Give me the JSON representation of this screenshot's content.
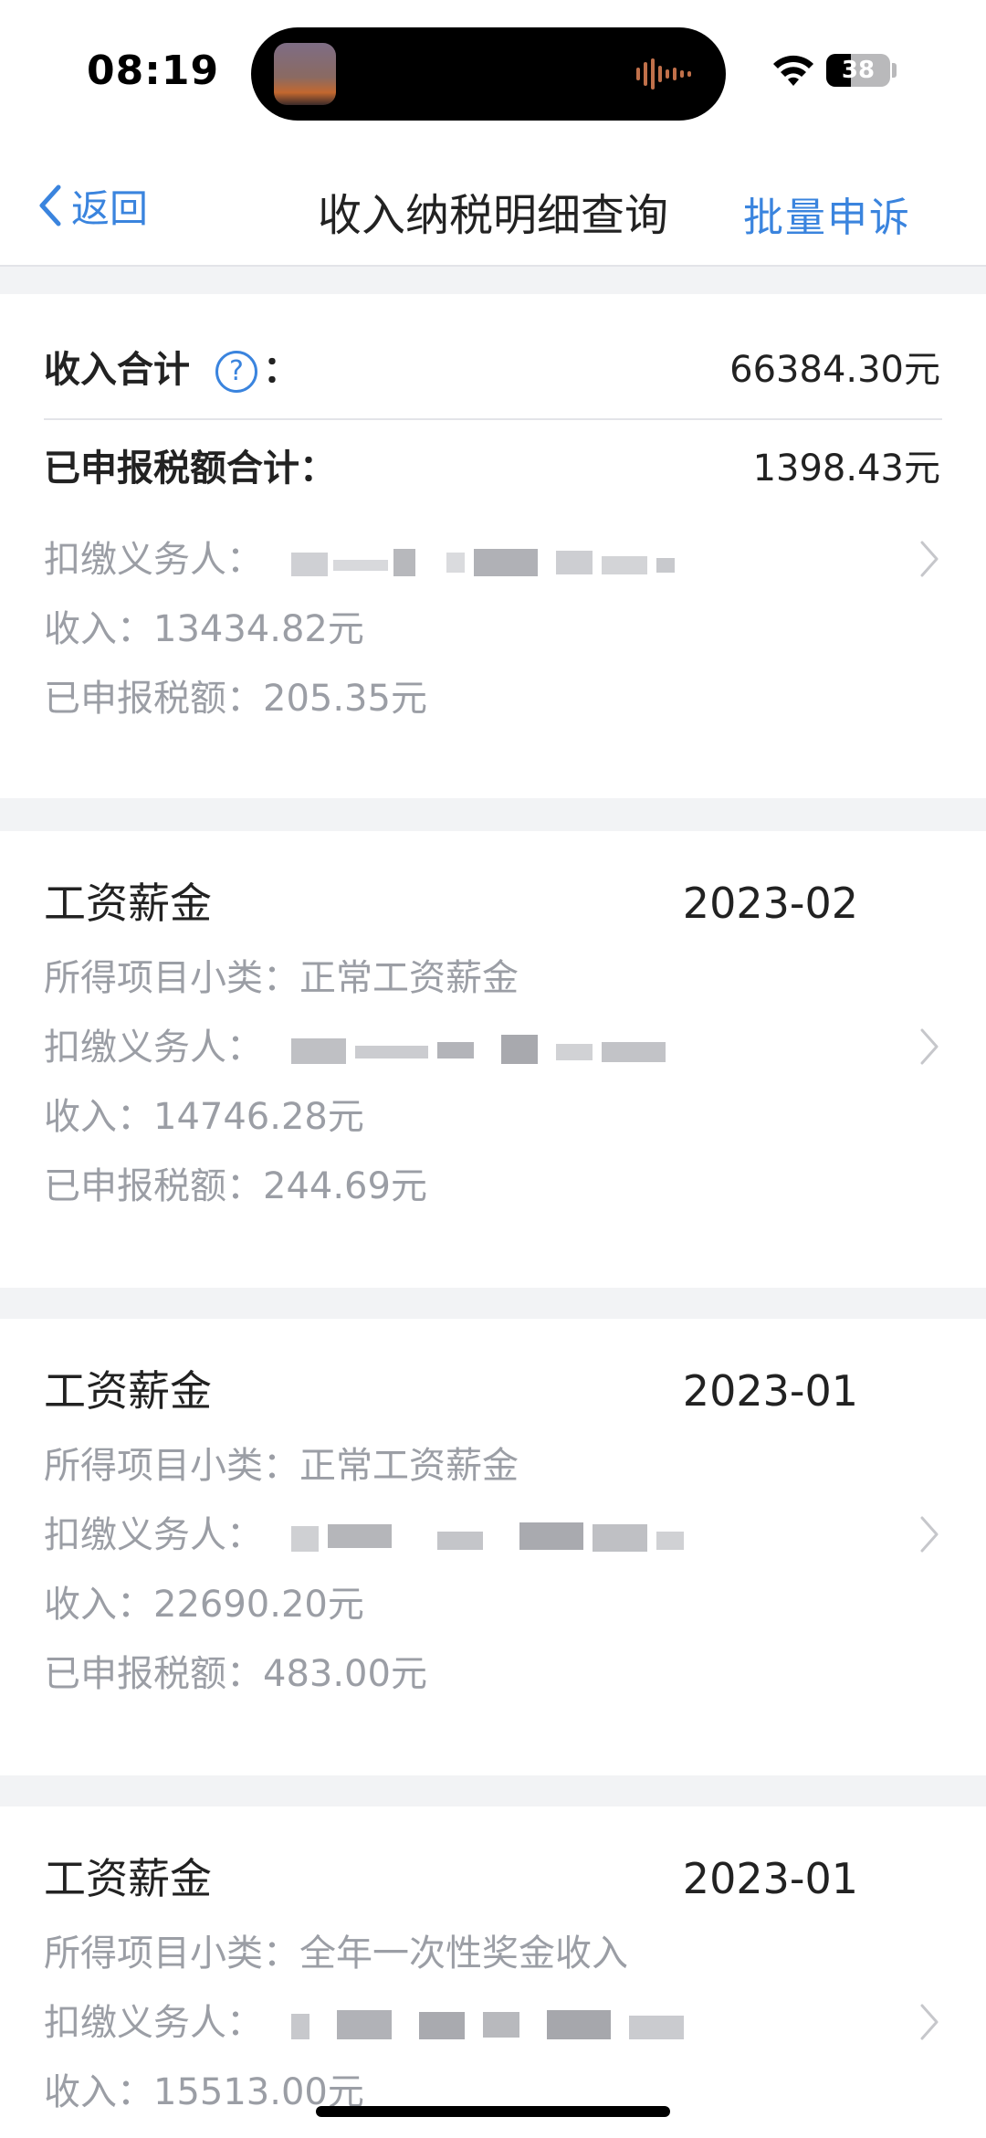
{
  "status_bar": {
    "time": "08:19",
    "battery": "38",
    "battery_level": 0.38
  },
  "nav": {
    "back_label": "返回",
    "title": "收入纳税明细查询",
    "right_action": "批量申诉"
  },
  "summary": {
    "income_total_label": "收入合计",
    "income_total_colon": "：",
    "help_symbol": "?",
    "income_total_value": "66384.30元",
    "tax_total_label": "已申报税额合计：",
    "tax_total_value": "1398.43元",
    "withholder_label": "扣缴义务人：",
    "income_line": "收入：13434.82元",
    "tax_line": "已申报税额：205.35元"
  },
  "records": [
    {
      "type": "工资薪金",
      "date": "2023-02",
      "subcategory_line": "所得项目小类：正常工资薪金",
      "withholder_label": "扣缴义务人：",
      "income_line": "收入：14746.28元",
      "tax_line": "已申报税额：244.69元"
    },
    {
      "type": "工资薪金",
      "date": "2023-01",
      "subcategory_line": "所得项目小类：正常工资薪金",
      "withholder_label": "扣缴义务人：",
      "income_line": "收入：22690.20元",
      "tax_line": "已申报税额：483.00元"
    },
    {
      "type": "工资薪金",
      "date": "2023-01",
      "subcategory_line": "所得项目小类：全年一次性奖金收入",
      "withholder_label": "扣缴义务人：",
      "income_line": "收入：15513.00元"
    }
  ],
  "colors": {
    "accent": "#3a84de",
    "muted_text": "#9b9ea5",
    "page_bg": "#f2f3f5"
  },
  "icons": {
    "back": "chevron-left-icon",
    "help": "question-circle-icon",
    "row": "chevron-right-icon"
  }
}
